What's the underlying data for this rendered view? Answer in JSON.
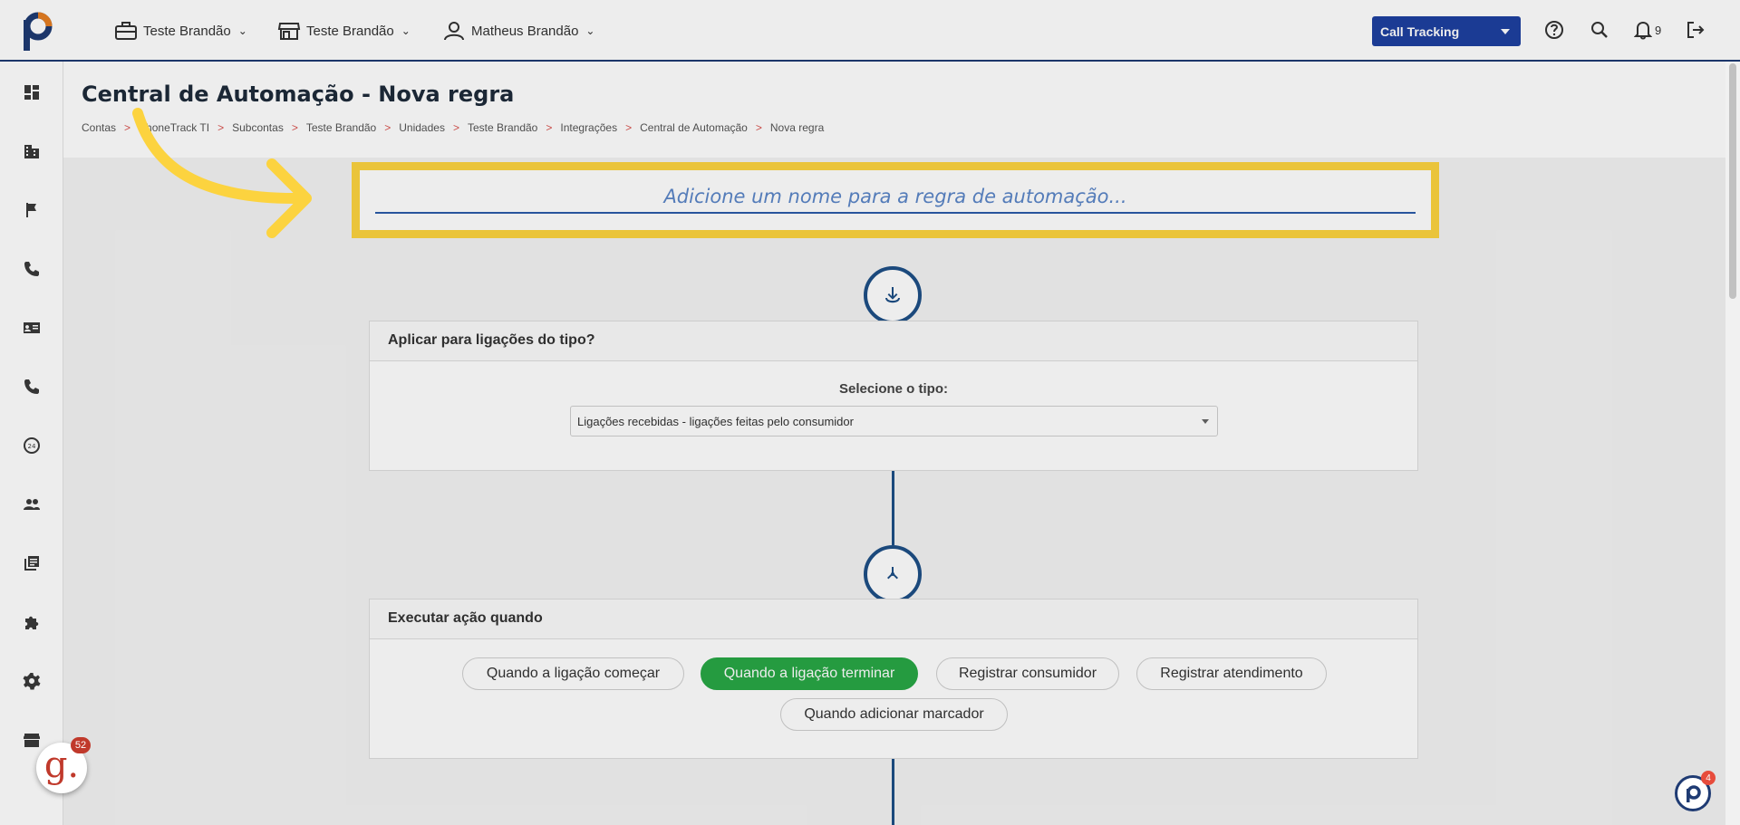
{
  "topbar": {
    "account_1": "Teste Brandão",
    "account_2": "Teste Brandão",
    "user": "Matheus Brandão",
    "product_select": "Call Tracking",
    "notification_count": "9"
  },
  "page": {
    "title": "Central de Automação - Nova regra",
    "breadcrumb": [
      "Contas",
      "PhoneTrack TI",
      "Subcontas",
      "Teste Brandão",
      "Unidades",
      "Teste Brandão",
      "Integrações",
      "Central de Automação",
      "Nova regra"
    ],
    "breadcrumb_separator": ">"
  },
  "rule_name": {
    "placeholder": "Adicione um nome para a regra de automação..."
  },
  "call_type_card": {
    "header": "Aplicar para ligações do tipo?",
    "select_label": "Selecione o tipo:",
    "selected_value": "Ligações recebidas - ligações feitas pelo consumidor"
  },
  "trigger_card": {
    "header": "Executar ação quando",
    "options": [
      {
        "label": "Quando a ligação começar",
        "active": false
      },
      {
        "label": "Quando a ligação terminar",
        "active": true
      },
      {
        "label": "Registrar consumidor",
        "active": false
      },
      {
        "label": "Registrar atendimento",
        "active": false
      },
      {
        "label": "Quando adicionar marcador",
        "active": false
      }
    ]
  },
  "widgets": {
    "g_badge": "52",
    "p_badge": "4"
  },
  "colors": {
    "brand_navy": "#1f3b73",
    "select_blue": "#1e40a0",
    "active_green": "#28a745",
    "highlight_yellow": "#fcd33f"
  }
}
